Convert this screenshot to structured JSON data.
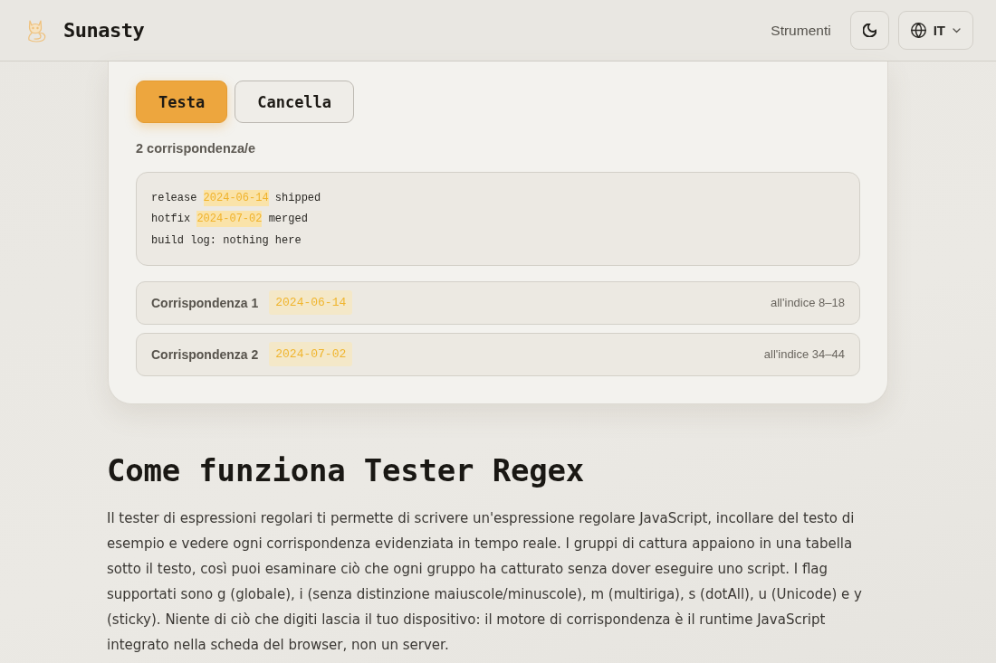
{
  "header": {
    "brand": "Sunasty",
    "nav": [
      {
        "label": "Strumenti"
      }
    ],
    "language": "IT"
  },
  "actions": [
    {
      "label": "Testa",
      "kind": "primary"
    },
    {
      "label": "Cancella",
      "kind": "secondary"
    }
  ],
  "match_count": "2 corrispondenza/e",
  "test_text": [
    [
      {
        "text": "release ",
        "match": false
      },
      {
        "text": "2024-06-14",
        "match": true
      },
      {
        "text": " shipped",
        "match": false
      }
    ],
    [
      {
        "text": "hotfix ",
        "match": false
      },
      {
        "text": "2024-07-02",
        "match": true
      },
      {
        "text": " merged",
        "match": false
      }
    ],
    [
      {
        "text": "build log: nothing here",
        "match": false
      }
    ]
  ],
  "matches": [
    {
      "label": "Corrispondenza 1",
      "value": "2024-06-14",
      "position": "all'indice 8–18"
    },
    {
      "label": "Corrispondenza 2",
      "value": "2024-07-02",
      "position": "all'indice 34–44"
    }
  ],
  "article": {
    "heading": "Come funziona Tester Regex",
    "body": "Il tester di espressioni regolari ti permette di scrivere un'espressione regolare JavaScript, incollare del testo di esempio e vedere ogni corrispondenza evidenziata in tempo reale. I gruppi di cattura appaiono in una tabella sotto il testo, così puoi esaminare ciò che ogni gruppo ha catturato senza dover eseguire uno script. I flag supportati sono g (globale), i (senza distinzione maiuscole/minuscole), m (multiriga), s (dotAll), u (Unicode) e y (sticky). Niente di ciò che digiti lascia il tuo dispositivo: il motore di corrispondenza è il runtime JavaScript integrato nella scheda del browser, non un server."
  }
}
